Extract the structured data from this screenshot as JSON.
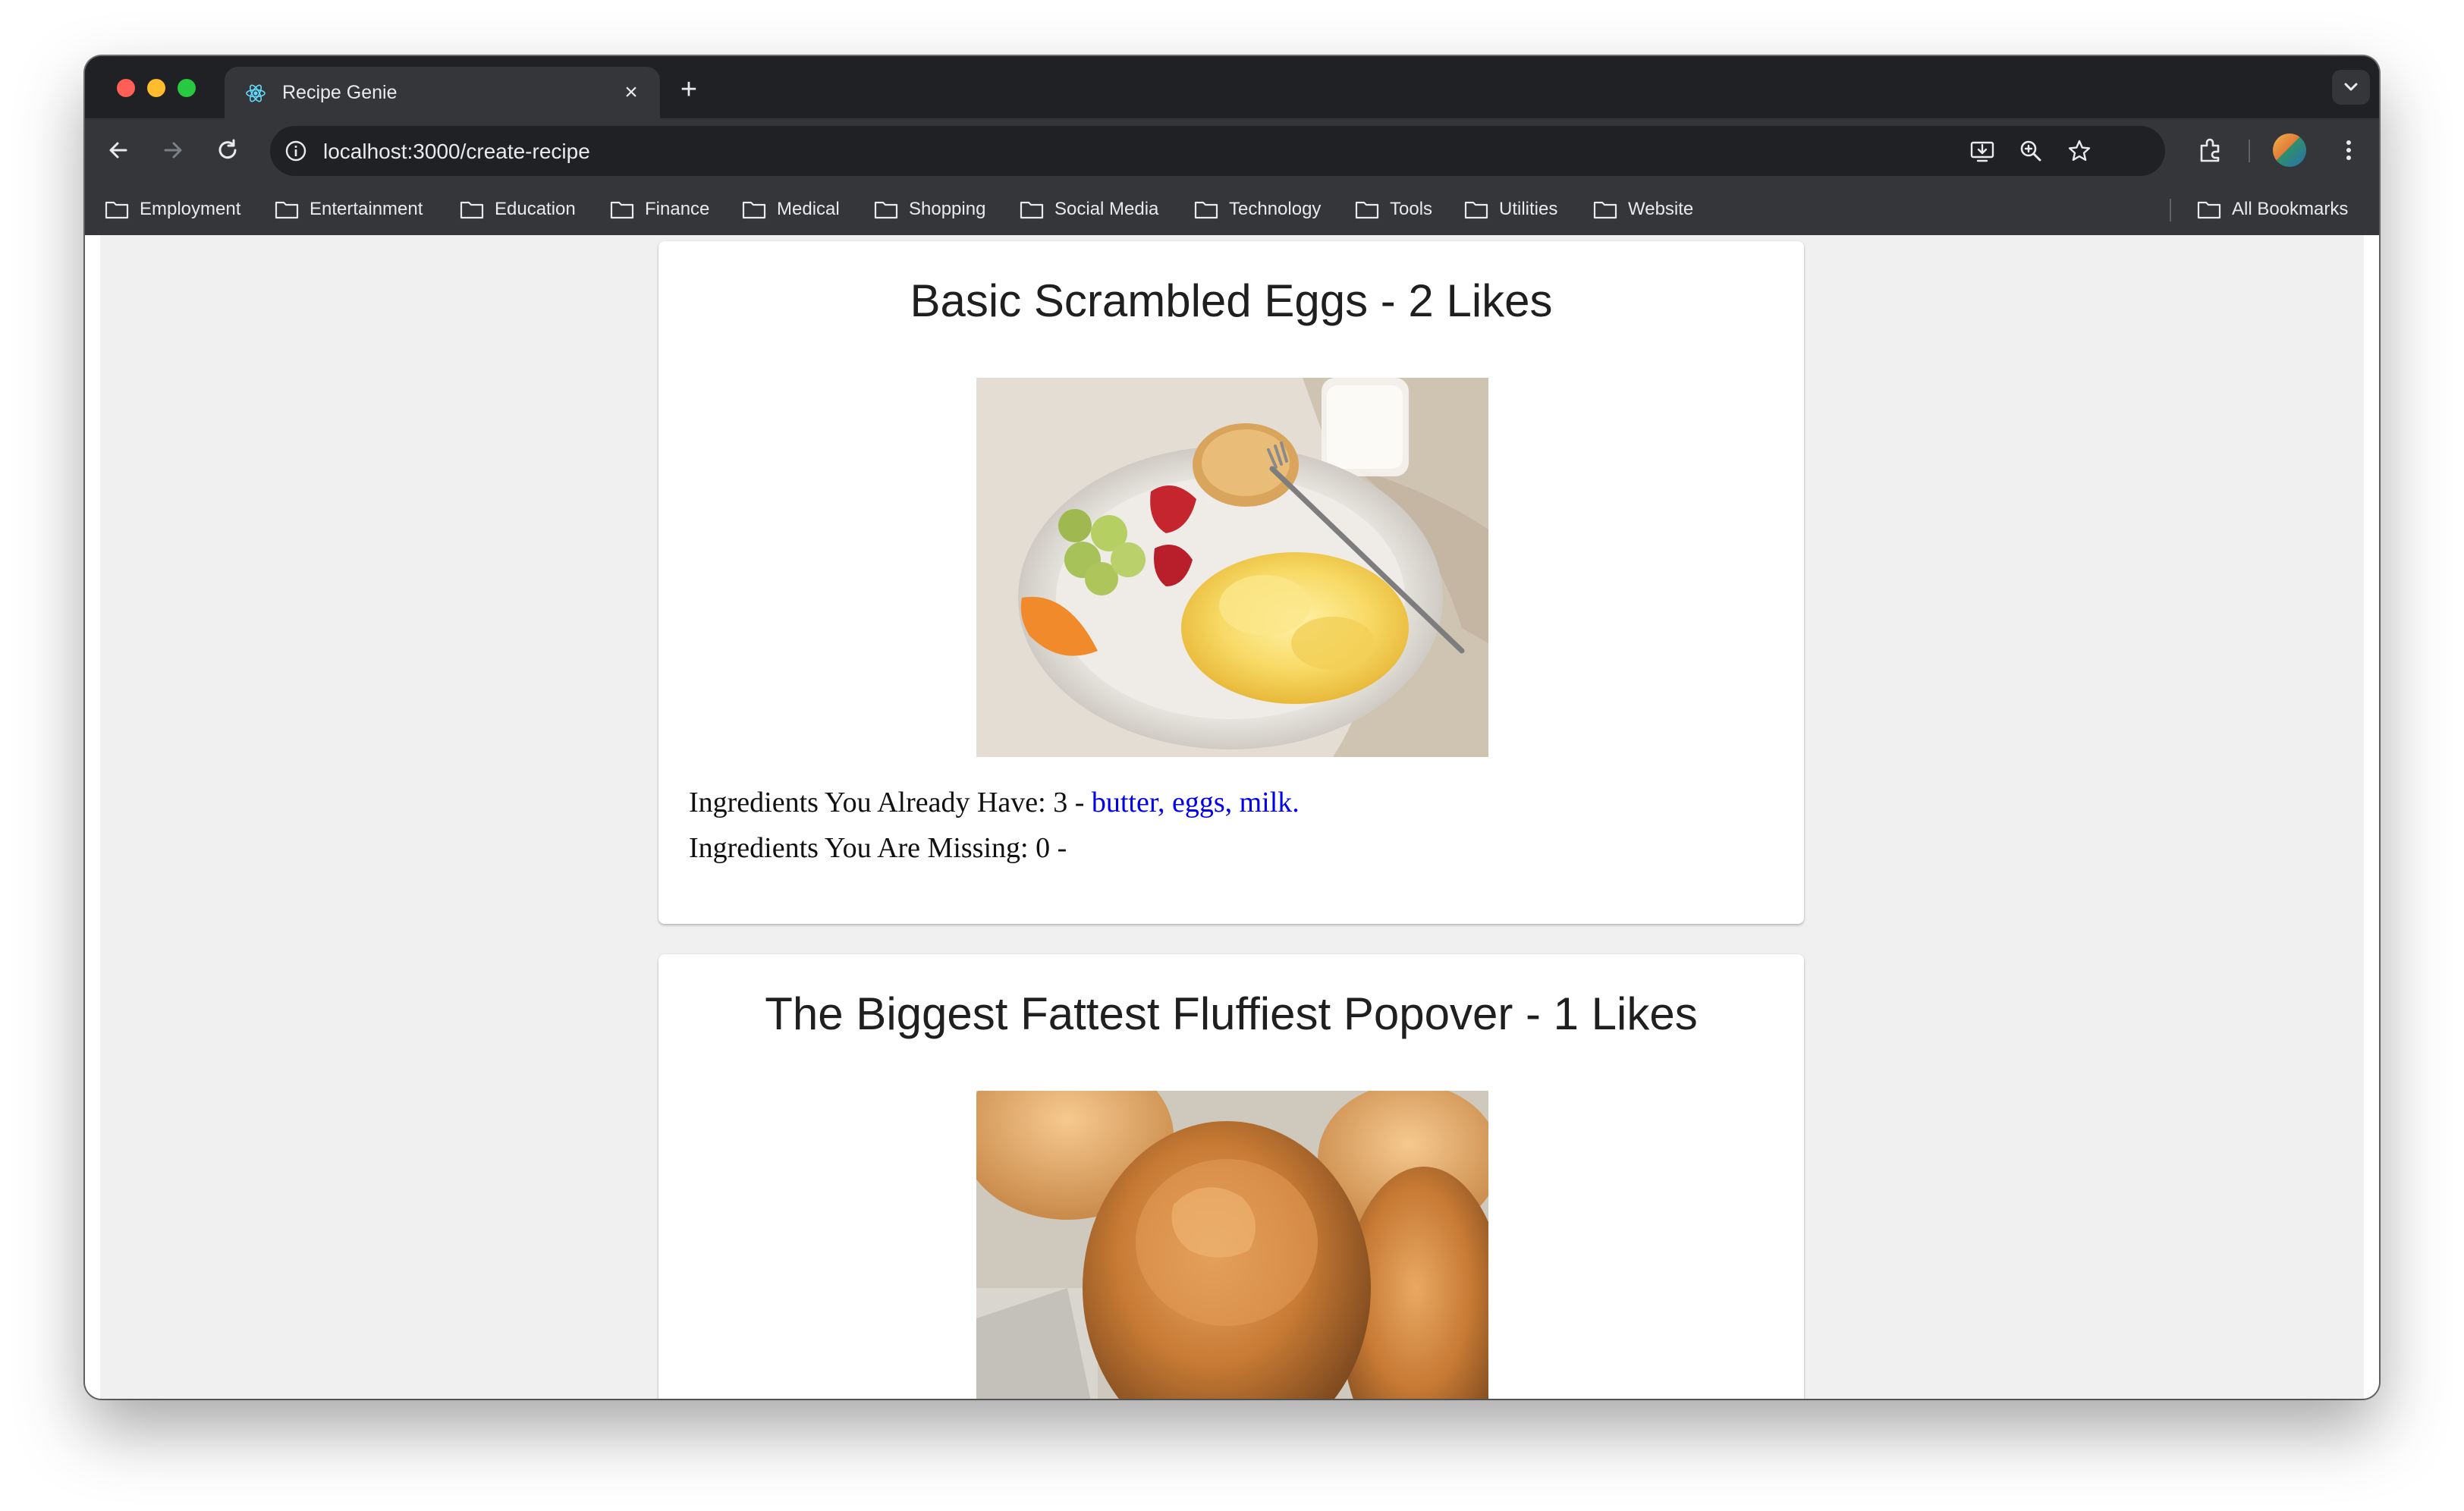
{
  "browser": {
    "tab_title": "Recipe Genie",
    "url_host": "localhost",
    "url_path": ":3000/create-recipe",
    "bookmarks": [
      "Employment",
      "Entertainment",
      "Education",
      "Finance",
      "Medical",
      "Shopping",
      "Social Media",
      "Technology",
      "Tools",
      "Utilities",
      "Website"
    ],
    "all_bookmarks": "All Bookmarks"
  },
  "recipes": [
    {
      "title": "Basic Scrambled Eggs - 2 Likes",
      "have_label": "Ingredients You Already Have: 3 - ",
      "have_items": "butter, eggs, milk.",
      "missing_label": "Ingredients You Are Missing: 0 -",
      "image": "scrambled-eggs-photo"
    },
    {
      "title": "The Biggest Fattest Fluffiest Popover - 1 Likes",
      "image": "popover-photo"
    }
  ],
  "colors": {
    "link": "#0000ee",
    "page_bg": "#f0f0f0",
    "browser_dark": "#202124",
    "browser_toolbar": "#35363a"
  }
}
